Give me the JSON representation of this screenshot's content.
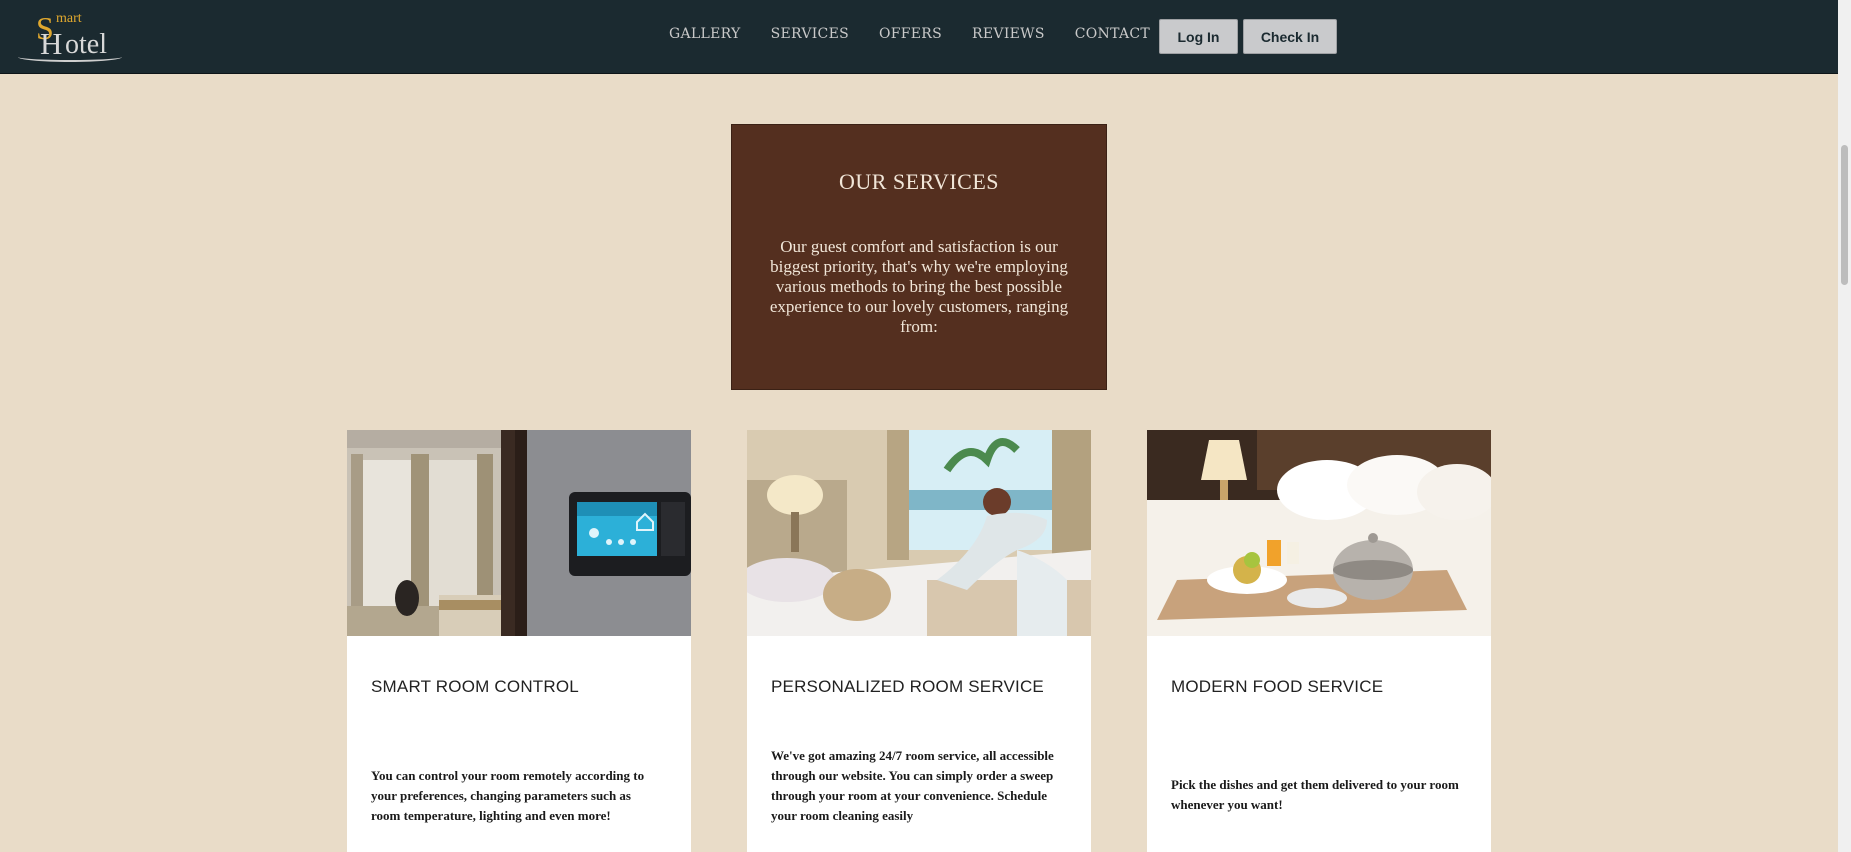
{
  "brand": {
    "logo_s": "S",
    "logo_mart": "mart",
    "logo_h": "H",
    "logo_otel": "otel",
    "accent_color": "#e0a82e"
  },
  "nav": {
    "links": [
      "GALLERY",
      "SERVICES",
      "OFFERS",
      "REVIEWS",
      "CONTACT"
    ],
    "login_label": "Log In",
    "checkin_label": "Check In"
  },
  "intro": {
    "title": "OUR SERVICES",
    "text": "Our guest comfort and satisfaction is our biggest priority, that's why we're employing various methods to bring the best possible experience to our lovely customers, ranging from:"
  },
  "services": [
    {
      "title": "SMART ROOM CONTROL",
      "text": "You can control your room remotely according to your preferences, changing parameters such as room temperature, lighting and even more!",
      "image": "smart-thermostat-room-photo"
    },
    {
      "title": "PERSONALIZED ROOM SERVICE",
      "text": "We've got amazing 24/7 room service, all accessible through our website. You can simply order a sweep through your room at your convenience. Schedule your room cleaning easily",
      "image": "housekeeping-bed-photo"
    },
    {
      "title": "MODERN FOOD SERVICE",
      "text": "Pick the dishes and get them delivered to your room whenever you want!",
      "image": "room-service-tray-photo"
    }
  ],
  "colors": {
    "page_bg": "#e9dcc8",
    "navbar_bg": "#1b2a30",
    "intro_bg": "#542f1f"
  }
}
